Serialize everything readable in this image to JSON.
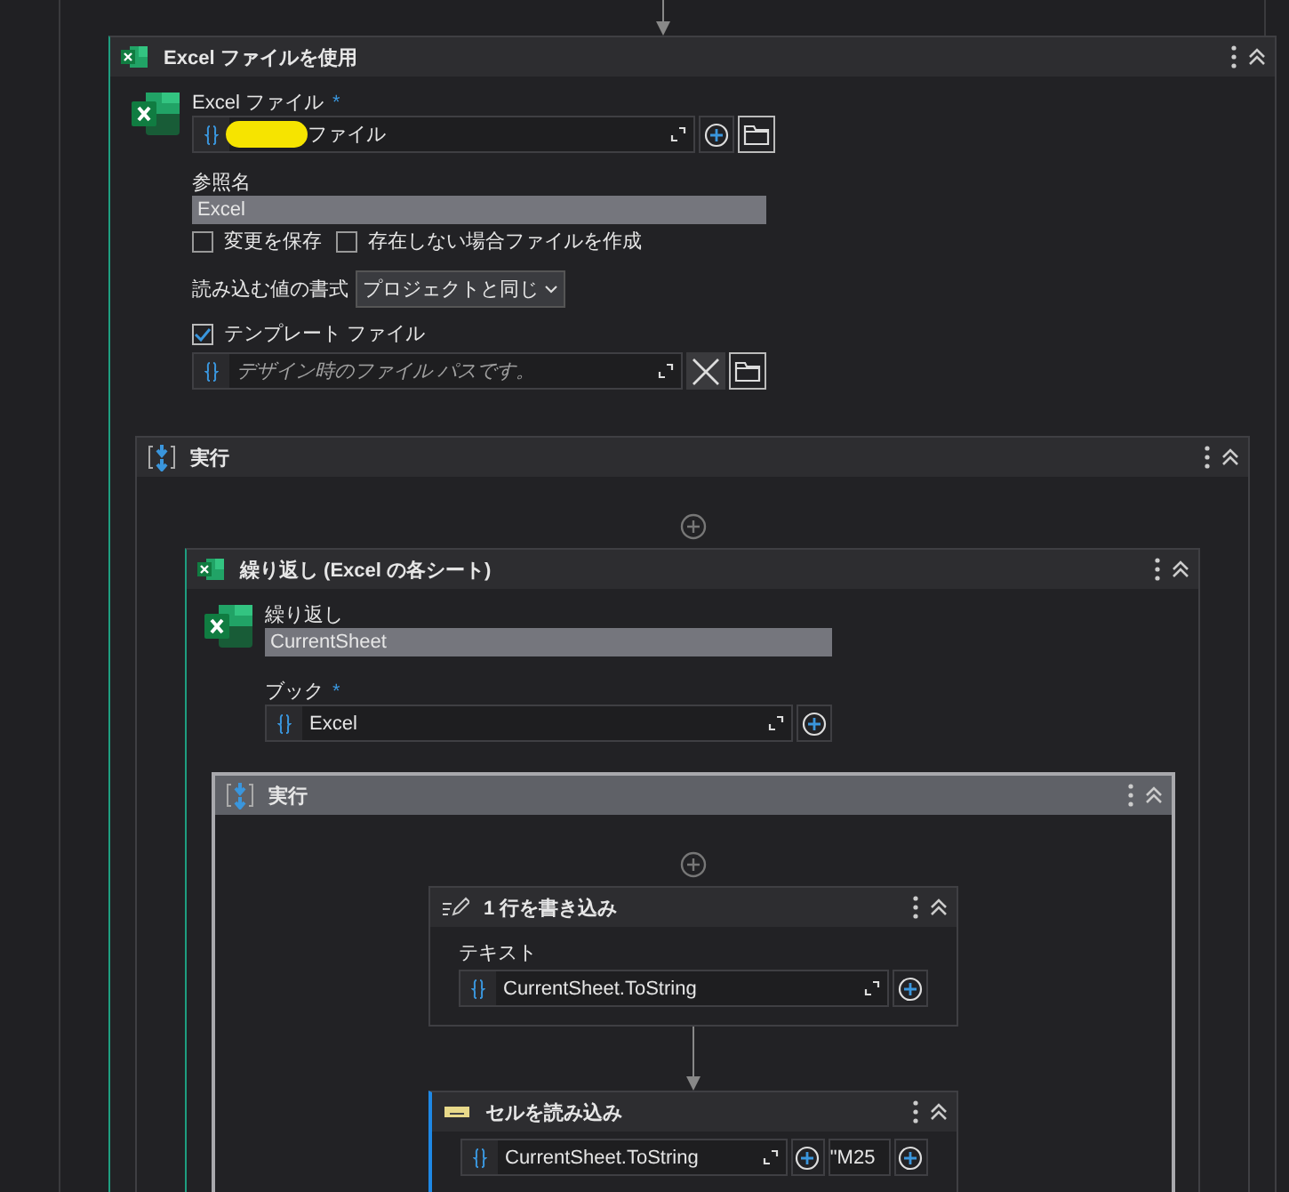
{
  "use_excel": {
    "title": "Excel ファイルを使用",
    "file_label": "Excel ファイル",
    "file_required_mark": "*",
    "file_value": "ファイル",
    "ref_label": "参照名",
    "ref_value": "Excel",
    "options": [
      {
        "label": "変更を保存",
        "checked": false
      },
      {
        "label": "存在しない場合ファイルを作成",
        "checked": false
      }
    ],
    "format_label": "読み込む値の書式",
    "format_value": "プロジェクトと同じ",
    "template": {
      "label": "テンプレート ファイル",
      "checked": true
    },
    "template_placeholder": "デザイン時のファイル パスです。",
    "do": {
      "title": "実行",
      "selected": false,
      "loop": {
        "title": "繰り返し (Excel の各シート)",
        "item_label": "繰り返し",
        "item_value": "CurrentSheet",
        "book_label": "ブック",
        "book_required_mark": "*",
        "book_value": "Excel",
        "do": {
          "title": "実行",
          "selected": true,
          "activities": [
            {
              "kind": "write_line",
              "title": "1 行を書き込み",
              "selected": false,
              "field_label": "テキスト",
              "value": "CurrentSheet.ToString"
            },
            {
              "kind": "read_cell",
              "title": "セルを読み込み",
              "selected": true,
              "sheet_value": "CurrentSheet.ToString",
              "cell_value": "\"M25"
            }
          ]
        }
      }
    }
  }
}
